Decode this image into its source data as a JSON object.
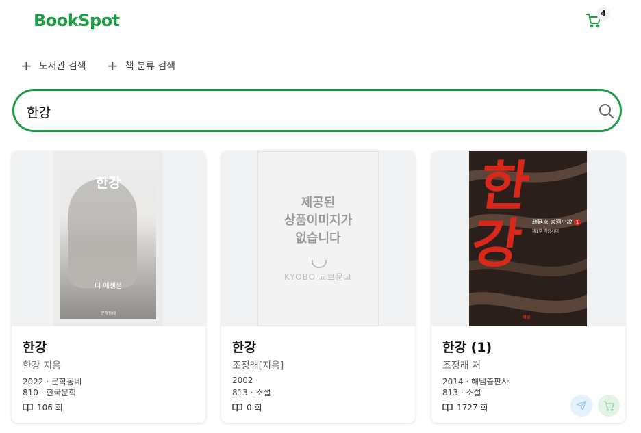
{
  "brand": "BookSpot",
  "cart": {
    "count": "4",
    "icon": "cart-icon"
  },
  "quick_search": [
    {
      "label": "도서관 검색",
      "icon": "plus-icon"
    },
    {
      "label": "책 분류 검색",
      "icon": "plus-icon"
    }
  ],
  "search": {
    "value": "한강",
    "icon": "search-icon"
  },
  "colors": {
    "accent": "#1f9d44",
    "card_cover_bg": "#f1f2f4"
  },
  "books": [
    {
      "title": "한강",
      "author": "한강 지음",
      "meta1": "2022 · 문학동네",
      "meta2": "810 · 한국문학",
      "views": "106 회",
      "cover": {
        "title": "한강",
        "small": "디 에센셜",
        "publisher": "문학동네"
      }
    },
    {
      "title": "한강",
      "author": "조정래[지음]",
      "meta1": "2002 ·",
      "meta2": "813 · 소설",
      "views": "0 회",
      "cover": {
        "line1": "제공된",
        "line2": "상품이미지가",
        "line3": "없습니다",
        "logo": "KYOBO 교보문고"
      }
    },
    {
      "title": "한강 (1)",
      "author": "조정래 저",
      "meta1": "2014 · 해냄출판사",
      "meta2": "813 · 소설",
      "views": "1727 회",
      "cover": {
        "title": "한강",
        "series": "趙廷來 大河小說",
        "volume": "1",
        "subtitle": "제1부 격랑시대",
        "publisher": "해냄"
      }
    }
  ],
  "floating": [
    {
      "icon": "send-icon"
    },
    {
      "icon": "cart-icon"
    }
  ]
}
